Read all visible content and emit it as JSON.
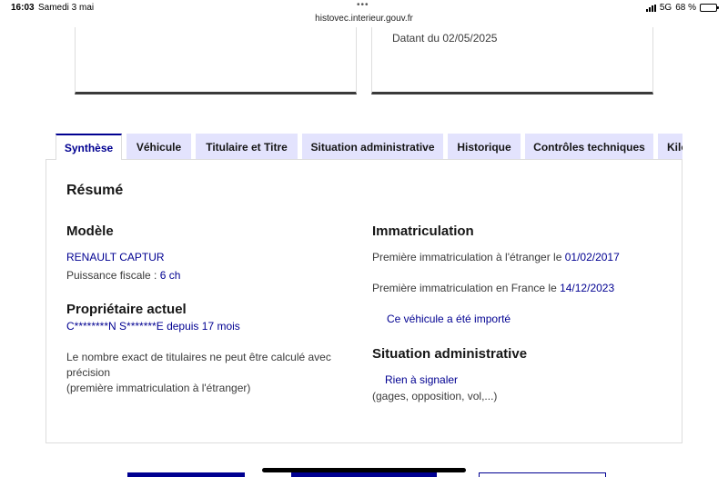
{
  "status": {
    "time": "16:03",
    "date": "Samedi 3 mai",
    "dots": "•••",
    "url": "histovec.interieur.gouv.fr",
    "network": "5G",
    "battery": "68 %",
    "battery_level": 0.68
  },
  "cards": {
    "right_date": "Datant du 02/05/2025"
  },
  "tabs": [
    {
      "label": "Synthèse"
    },
    {
      "label": "Véhicule"
    },
    {
      "label": "Titulaire et Titre"
    },
    {
      "label": "Situation administrative"
    },
    {
      "label": "Historique"
    },
    {
      "label": "Contrôles techniques"
    },
    {
      "label": "Kilo"
    }
  ],
  "panel": {
    "title": "Résumé",
    "model": {
      "heading": "Modèle",
      "name": "RENAULT CAPTUR",
      "fiscal_label": "Puissance fiscale : ",
      "fiscal_value": "6 ch"
    },
    "owner": {
      "heading": "Propriétaire actuel",
      "name": "C********N S*******E",
      "since_label": " depuis ",
      "since_value": "17 mois",
      "note_line1": "Le nombre exact de titulaires ne peut être calculé avec",
      "note_line2": "précision",
      "note_line3": "(première immatriculation à l'étranger)"
    },
    "registration": {
      "heading": "Immatriculation",
      "foreign_label": "Première immatriculation à l'étranger le ",
      "foreign_date": "01/02/2017",
      "france_label": "Première immatriculation en France le ",
      "france_date": "14/12/2023",
      "imported_link": "Ce véhicule a été importé"
    },
    "admin": {
      "heading": "Situation administrative",
      "status_link": "Rien à signaler",
      "details": "(gages, opposition, vol,...)"
    }
  }
}
